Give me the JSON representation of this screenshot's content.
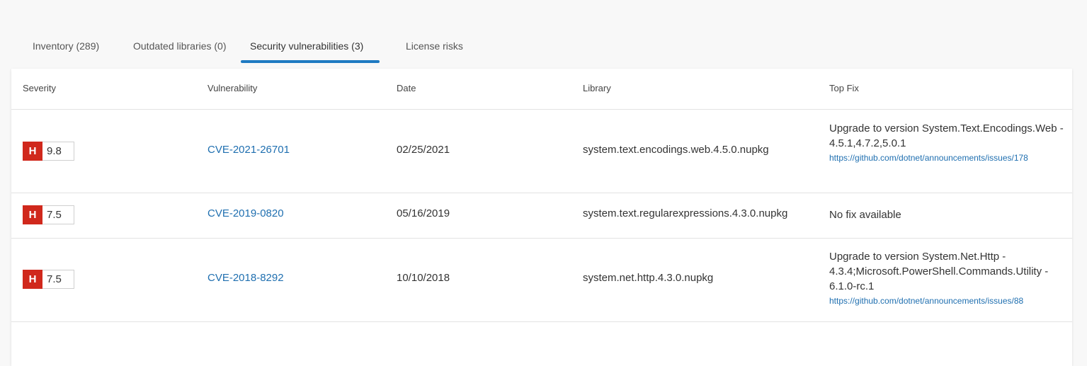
{
  "tabs": [
    {
      "label": "Inventory (289)"
    },
    {
      "label": "Outdated libraries (0)"
    },
    {
      "label": "Security vulnerabilities (3)"
    },
    {
      "label": "License risks"
    }
  ],
  "active_tab": "Security vulnerabilities (3)",
  "table": {
    "headers": {
      "severity": "Severity",
      "vulnerability": "Vulnerability",
      "date": "Date",
      "library": "Library",
      "top_fix": "Top Fix"
    },
    "rows": [
      {
        "severity_letter": "H",
        "score": "9.8",
        "cve": "CVE-2021-26701",
        "date": "02/25/2021",
        "library": "system.text.encodings.web.4.5.0.nupkg",
        "fix_text": "Upgrade to version System.Text.Encodings.Web - 4.5.1,4.7.2,5.0.1",
        "fix_link": "https://github.com/dotnet/announcements/issues/178"
      },
      {
        "severity_letter": "H",
        "score": "7.5",
        "cve": "CVE-2019-0820",
        "date": "05/16/2019",
        "library": "system.text.regularexpressions.4.3.0.nupkg",
        "fix_text": "No fix available",
        "fix_link": ""
      },
      {
        "severity_letter": "H",
        "score": "7.5",
        "cve": "CVE-2018-8292",
        "date": "10/10/2018",
        "library": "system.net.http.4.3.0.nupkg",
        "fix_text": "Upgrade to version System.Net.Http - 4.3.4;Microsoft.PowerShell.Commands.Utility - 6.1.0-rc.1",
        "fix_link": "https://github.com/dotnet/announcements/issues/88"
      }
    ]
  },
  "colors": {
    "accent": "#1f7ac2",
    "link": "#1f6fb0",
    "severity_high": "#d0281c"
  }
}
